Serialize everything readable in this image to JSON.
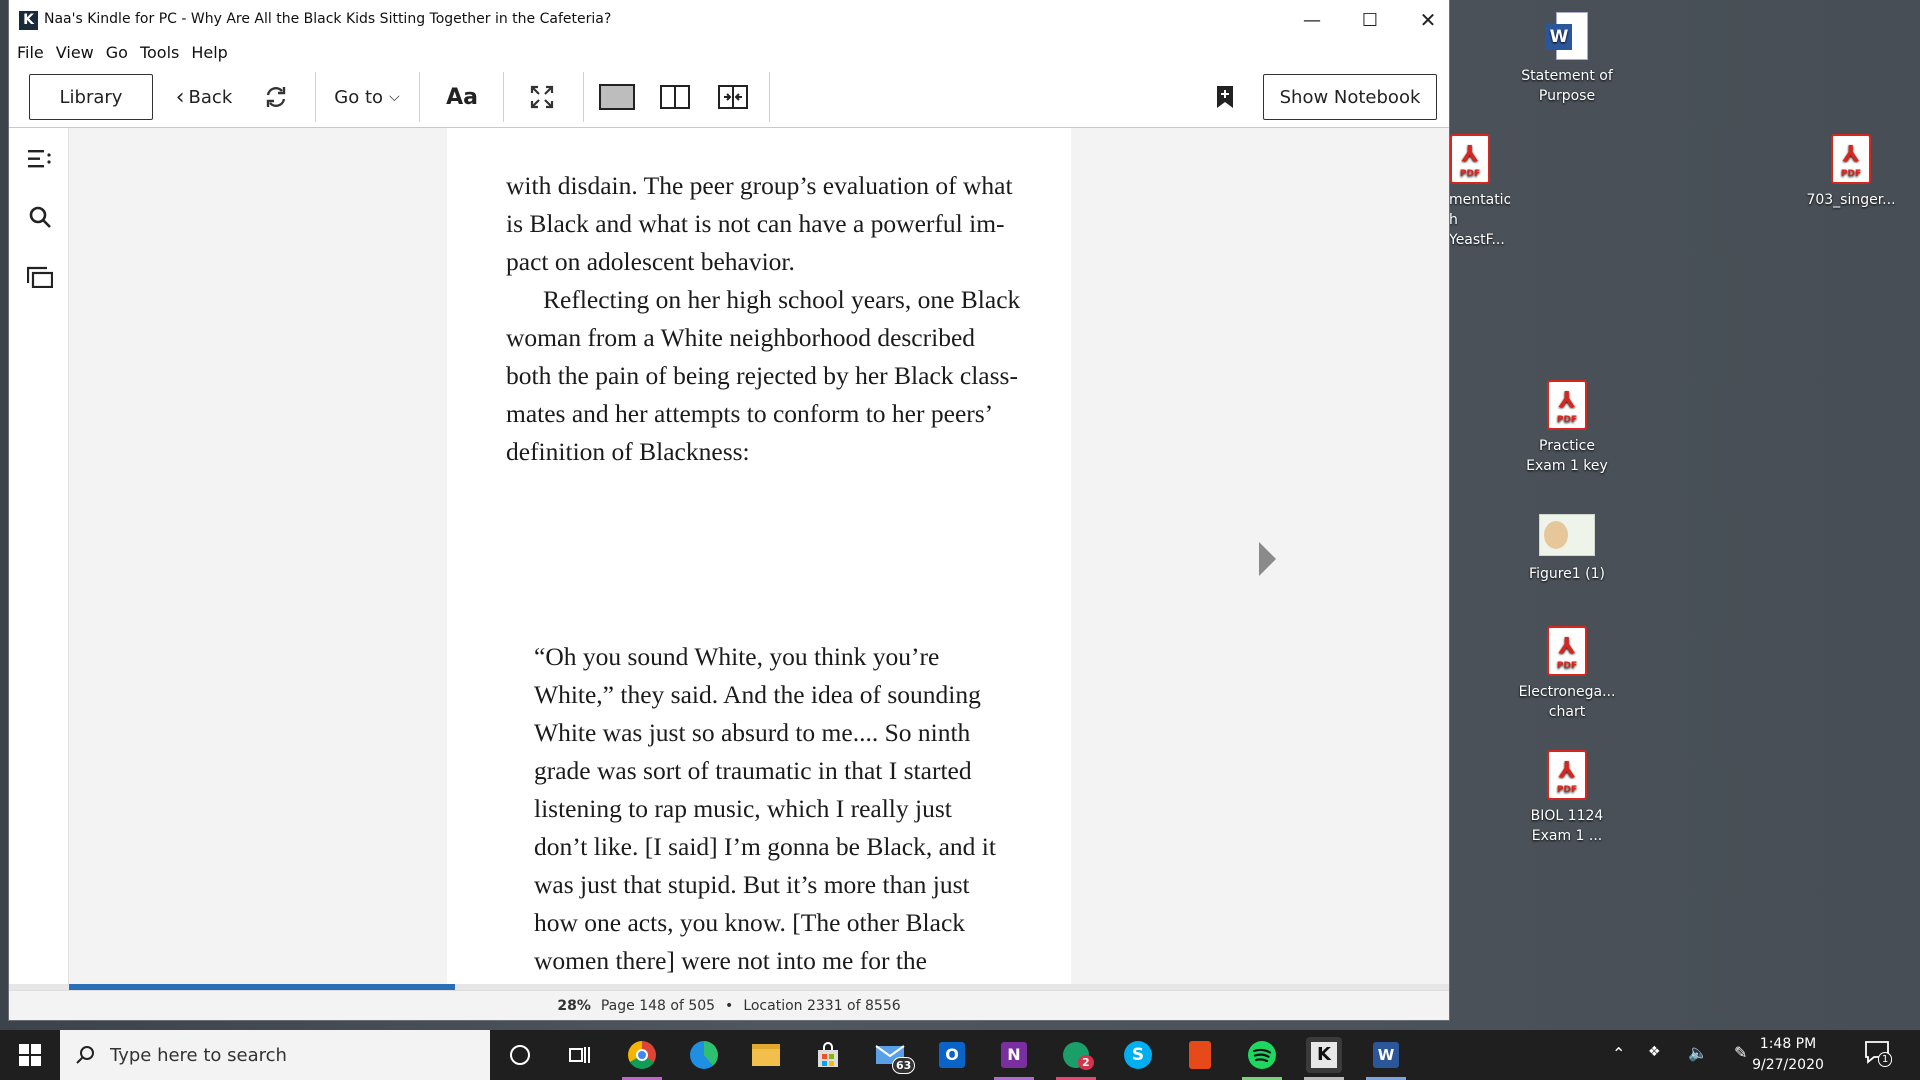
{
  "window": {
    "title": "Naa's Kindle for PC - Why Are All the Black Kids Sitting Together in the Cafeteria?",
    "minimize": "—",
    "maximize": "☐",
    "close": "✕"
  },
  "menu": [
    "File",
    "View",
    "Go",
    "Tools",
    "Help"
  ],
  "toolbar": {
    "library": "Library",
    "back": "Back",
    "goto": "Go to",
    "font": "Aa",
    "show_notebook": "Show Notebook"
  },
  "book": {
    "para1_line": "with disdain. The peer group’s evaluation of what is Black and what is not can have a powerful im­pact on adolescent behavior.",
    "para2": "Reflecting on her high school years, one Black woman from a White neighborhood described both the pain of being rejected by her Black class­mates and her attempts to conform to her peers’ definition of Blackness:",
    "quote": "“Oh you sound White, you think you’re White,” they said. And the idea of sounding White was just so absurd to me.... So ninth grade was sort of traumatic in that I started listening to rap music, which I really just don’t like. [I said] I’m gonna be Black, and it was just that stupid. But it’s more than just how one acts, you know. [The other Black women there] were not into me for the longest time. My first year there was hell."
  },
  "status": {
    "percent": "28%",
    "page": "Page 148 of 505",
    "dot": "•",
    "location": "Location 2331 of 8556",
    "progress_fraction": 0.28
  },
  "desktop": [
    {
      "label1": "Statement of",
      "label2": "Purpose",
      "type": "word"
    },
    {
      "label1": "mentation",
      "label2": "h YeastF...",
      "type": "pdf"
    },
    {
      "label1": "703_singer...",
      "label2": "",
      "type": "pdf"
    },
    {
      "label1": "Practice",
      "label2": "Exam 1 key",
      "type": "pdf"
    },
    {
      "label1": "Figure1 (1)",
      "label2": "",
      "type": "image"
    },
    {
      "label1": "Electronega...",
      "label2": "chart",
      "type": "pdf"
    },
    {
      "label1": "BIOL 1124",
      "label2": "Exam 1 ...",
      "type": "pdf"
    }
  ],
  "pdf_label": "PDF",
  "taskbar": {
    "search_placeholder": "Type here to search",
    "mail_badge": "63",
    "flower_badge": "2",
    "time": "1:48 PM",
    "date": "9/27/2020",
    "notif_badge": "1"
  }
}
